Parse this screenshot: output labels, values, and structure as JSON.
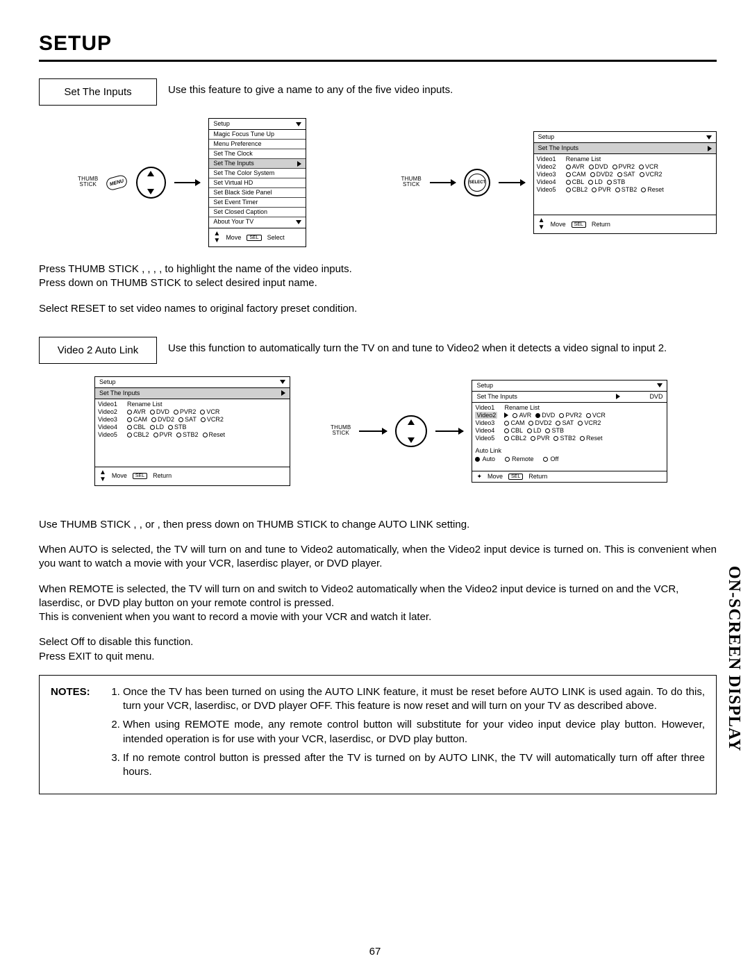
{
  "heading": "SETUP",
  "sidetab": "ON-SCREEN DISPLAY",
  "page_num": "67",
  "set_inputs": {
    "label": "Set The Inputs",
    "desc": "Use this feature to give a name to any of the five video inputs."
  },
  "thumbstick_label": "THUMB\nSTICK",
  "menu_badge": "MENU",
  "select_label": "SELECT",
  "setup_menu": {
    "title": "Setup",
    "items": [
      "Magic Focus Tune Up",
      "Menu Preference",
      "Set The Clock",
      "Set The Inputs",
      "Set The Color System",
      "Set Virtual HD",
      "Set Black Side Panel",
      "Set Event Timer",
      "Set Closed Caption",
      "About Your TV"
    ],
    "foot_move": "Move",
    "foot_action": "Select",
    "sel_badge": "SEL"
  },
  "inputs_menu": {
    "title": "Setup",
    "subtitle": "Set The Inputs",
    "rows": [
      "Video1",
      "Video2",
      "Video3",
      "Video4",
      "Video5"
    ],
    "row_labels": {
      "Video1": "Rename List",
      "Video2": [
        "AVR",
        "DVD",
        "PVR2",
        "VCR"
      ],
      "Video3": [
        "CAM",
        "DVD2",
        "SAT",
        "VCR2"
      ],
      "Video4": [
        "CBL",
        "LD",
        "STB"
      ],
      "Video5": [
        "CBL2",
        "PVR",
        "STB2",
        "Reset"
      ]
    },
    "foot_move": "Move",
    "foot_action": "Return"
  },
  "dvd_tag": "DVD",
  "autolink": {
    "title": "Auto Link",
    "opts": [
      "Auto",
      "Remote",
      "Off"
    ]
  },
  "para1a": "Press THUMB STICK    ,    ,    ,    , to highlight the name of the video inputs.",
  "para1b": "Press down on THUMB STICK to select desired input name.",
  "para1c": "Select RESET to set video names to original factory preset condition.",
  "auto_link": {
    "label": "Video 2 Auto Link",
    "desc": "Use this function to automatically turn the TV on and tune to Video2 when it detects a video signal to input 2."
  },
  "para2a": "Use THUMB STICK    ,    ,     or    , then press down on THUMB STICK to change AUTO LINK setting.",
  "para2b": "When AUTO is selected, the TV will turn on and tune to Video2 automatically, when the Video2 input device is turned on. This is convenient when you want to watch a movie with your VCR, laserdisc player, or DVD player.",
  "para2c": "When REMOTE is selected, the TV will turn on and switch to Video2 automatically when the Video2 input device is turned on and the VCR, laserdisc, or DVD play button on your remote control is pressed.",
  "para2d": "This is convenient when you want to record a movie with your VCR and watch it later.",
  "para2e": "Select Off to disable this function.",
  "para2f": "Press EXIT to quit menu.",
  "notes_label": "NOTES:",
  "notes": [
    "Once the TV has been turned on using the AUTO LINK feature, it must be reset before AUTO LINK is used again. To do this, turn your VCR, laserdisc, or DVD player OFF. This feature is now reset and will turn on your TV as described above.",
    "When using REMOTE mode, any remote control button will substitute for your video input device play button. However, intended operation is for use with your VCR, laserdisc, or DVD play button.",
    "If no remote control button is pressed after the TV is turned on by AUTO LINK, the TV will automatically turn off after three hours."
  ]
}
